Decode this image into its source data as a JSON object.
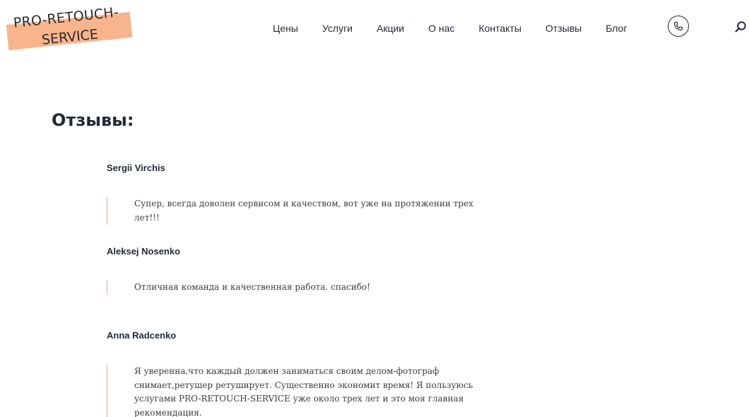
{
  "logo": {
    "line1": "PRO-RETOUCH-",
    "line2": "SERVICE",
    "band_color": "#f8b58c"
  },
  "nav": {
    "items": [
      {
        "label": "Цены"
      },
      {
        "label": "Услуги"
      },
      {
        "label": "Акции"
      },
      {
        "label": "О нас"
      },
      {
        "label": "Контакты"
      },
      {
        "label": "Отзывы"
      },
      {
        "label": "Блог"
      }
    ],
    "phone_icon": "phone-icon",
    "search_icon": "search-icon"
  },
  "main": {
    "title": "Отзывы:",
    "reviews": [
      {
        "author": "Sergii Virchis",
        "text": "Супер, всегда доволен сервисом и качеством, вот уже на протяжении трех лет!!!"
      },
      {
        "author": "Aleksej Nosenko",
        "text": "Отличная команда и качественная работа. спасибо!"
      },
      {
        "author": "Anna Radcenko",
        "text": "Я уверенна,что каждый должен заниматься своим делом-фотограф снимает,ретушер ретуширует. Существенно экономит время! Я пользуюсь услугами PRO-RETOUCH-SERVICE уже около трех лет и это моя главная рекомендация."
      }
    ]
  },
  "colors": {
    "accent": "#f0a274",
    "text": "#1f2a37"
  }
}
